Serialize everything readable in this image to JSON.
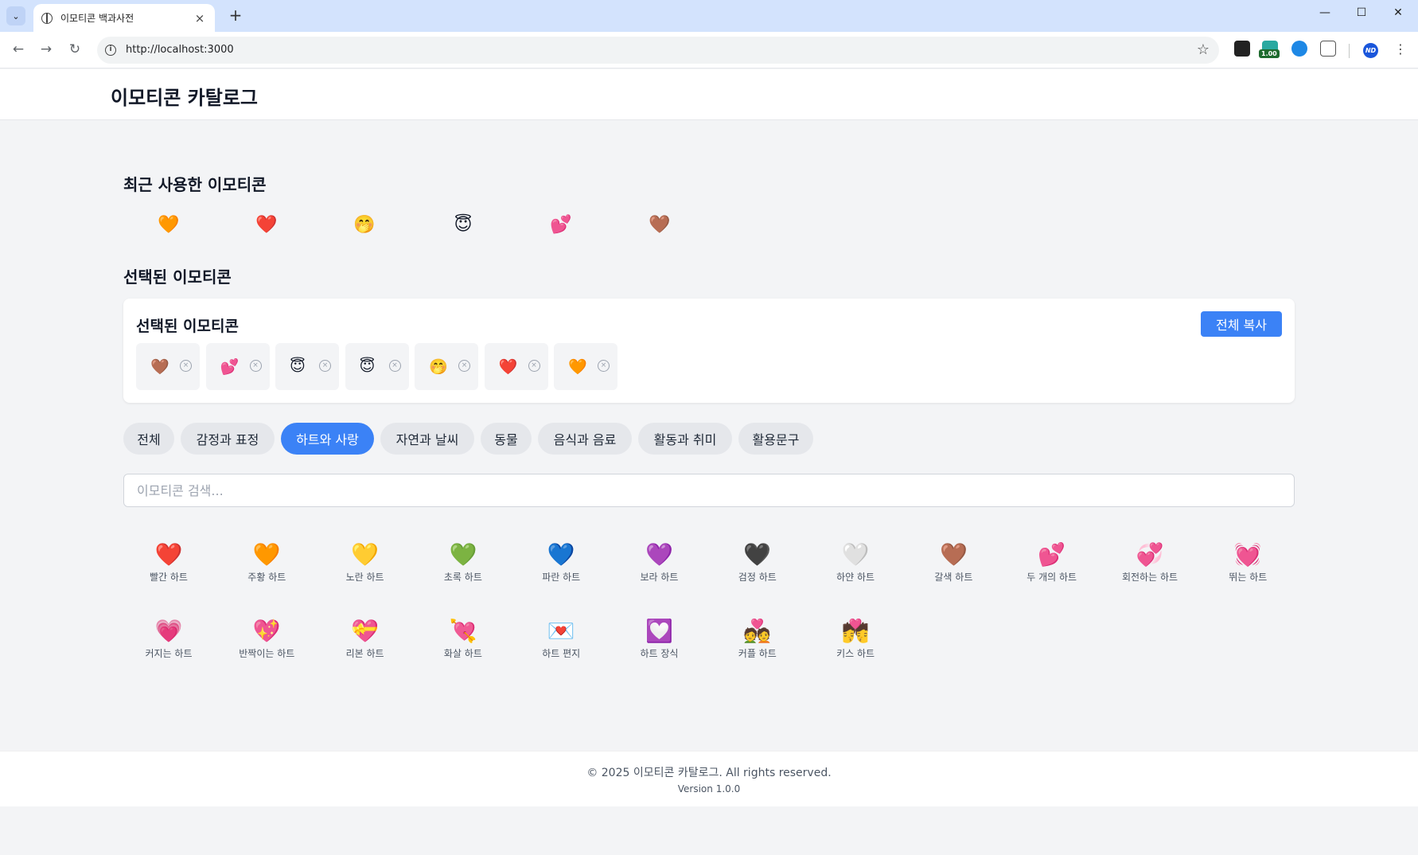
{
  "browser": {
    "tab_title": "이모티콘 백과사전",
    "url": "http://localhost:3000",
    "extension_badge": "1.00",
    "profile_initials": "ND"
  },
  "header": {
    "title": "이모티콘 카탈로그"
  },
  "recent": {
    "title": "최근 사용한 이모티콘",
    "items": [
      "🧡",
      "❤️",
      "🤭",
      "😇",
      "💕",
      "🤎"
    ]
  },
  "selected": {
    "section_title": "선택된 이모티콘",
    "card_title": "선택된 이모티콘",
    "copy_all_label": "전체 복사",
    "items": [
      "🤎",
      "💕",
      "😇",
      "😇",
      "🤭",
      "❤️",
      "🧡"
    ],
    "remove_glyph": "×"
  },
  "categories": {
    "active": "하트와 사랑",
    "items": [
      "전체",
      "감정과 표정",
      "하트와 사랑",
      "자연과 날씨",
      "동물",
      "음식과 음료",
      "활동과 취미",
      "활용문구"
    ]
  },
  "search": {
    "placeholder": "이모티콘 검색..."
  },
  "emoji_grid": [
    {
      "glyph": "❤️",
      "name": "빨간 하트"
    },
    {
      "glyph": "🧡",
      "name": "주황 하트"
    },
    {
      "glyph": "💛",
      "name": "노란 하트"
    },
    {
      "glyph": "💚",
      "name": "초록 하트"
    },
    {
      "glyph": "💙",
      "name": "파란 하트"
    },
    {
      "glyph": "💜",
      "name": "보라 하트"
    },
    {
      "glyph": "🖤",
      "name": "검정 하트"
    },
    {
      "glyph": "🤍",
      "name": "하얀 하트"
    },
    {
      "glyph": "🤎",
      "name": "갈색 하트"
    },
    {
      "glyph": "💕",
      "name": "두 개의 하트"
    },
    {
      "glyph": "💞",
      "name": "회전하는 하트"
    },
    {
      "glyph": "💓",
      "name": "뛰는 하트"
    },
    {
      "glyph": "💗",
      "name": "커지는 하트"
    },
    {
      "glyph": "💖",
      "name": "반짝이는 하트"
    },
    {
      "glyph": "💝",
      "name": "리본 하트"
    },
    {
      "glyph": "💘",
      "name": "화살 하트"
    },
    {
      "glyph": "💌",
      "name": "하트 편지"
    },
    {
      "glyph": "💟",
      "name": "하트 장식"
    },
    {
      "glyph": "💑",
      "name": "커플 하트"
    },
    {
      "glyph": "💏",
      "name": "키스 하트"
    }
  ],
  "footer": {
    "copyright": "© 2025 이모티콘 카탈로그. All rights reserved.",
    "version": "Version 1.0.0"
  },
  "colors": {
    "accent": "#3b82f6",
    "chip_bg": "#e5e7eb",
    "page_bg": "#f3f4f6"
  }
}
